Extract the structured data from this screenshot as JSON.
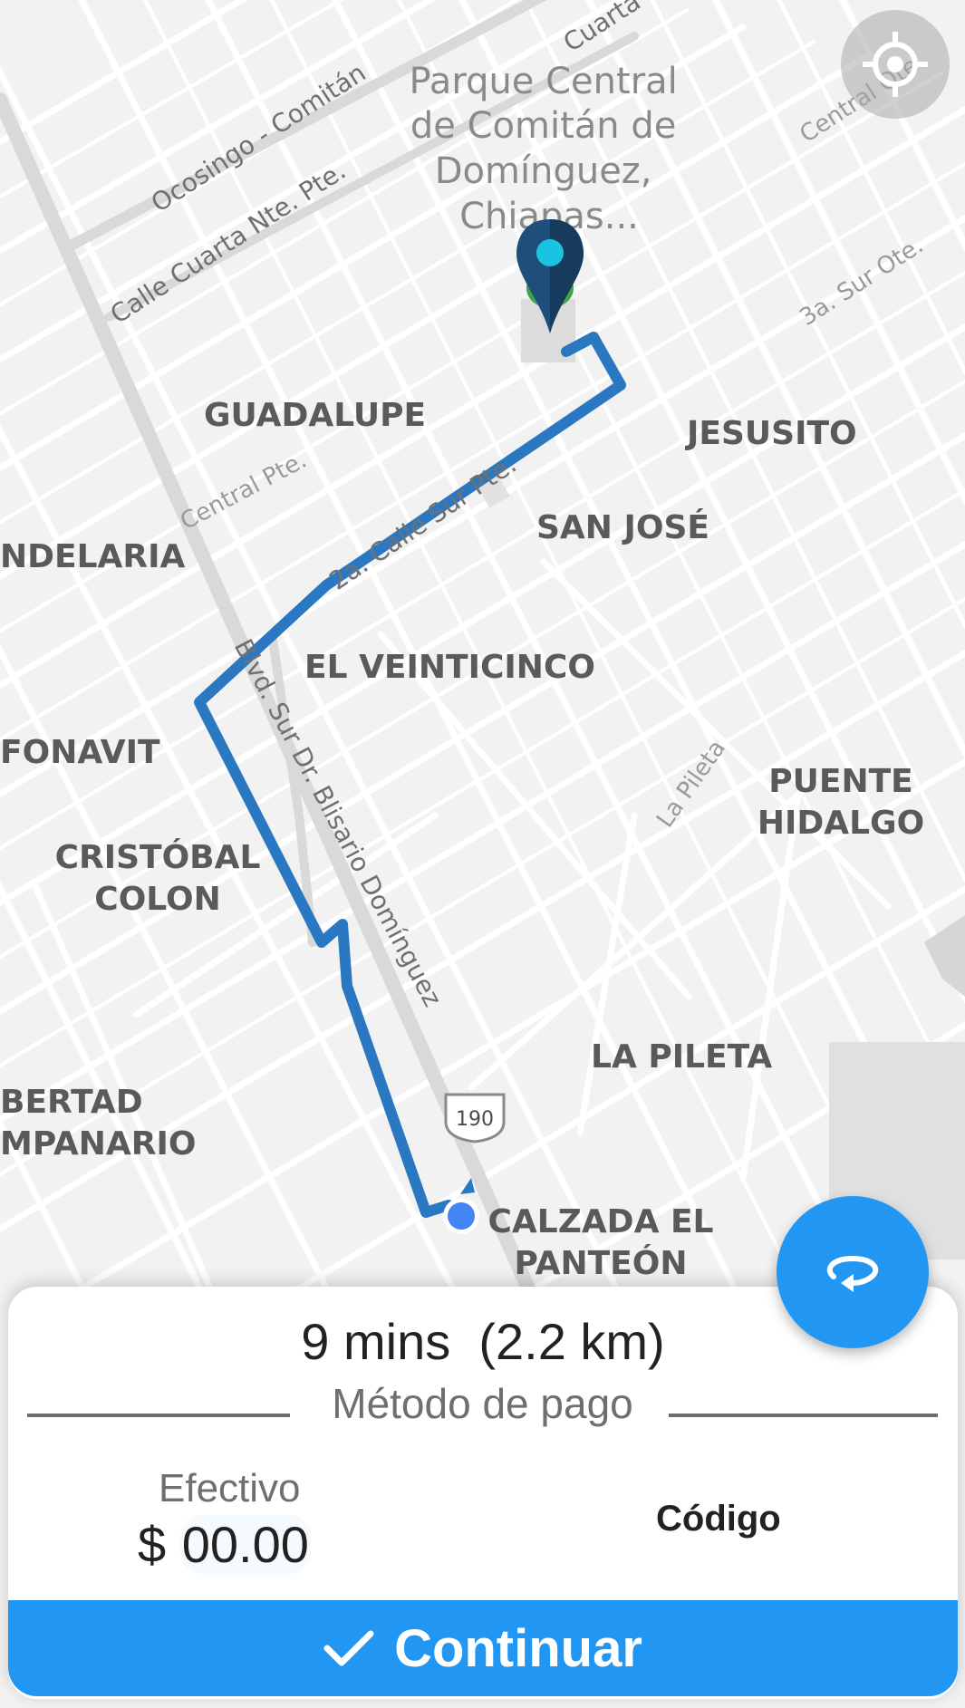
{
  "map": {
    "poi_label_lines": [
      "Parque Central",
      "de Comitán de",
      "Domínguez,",
      "Chiapas..."
    ],
    "road_labels": {
      "ocosingo": "Ocosingo - Comitán",
      "cuarta_nte": "Calle Cuarta Nte. Pte.",
      "cuarta_top": "Cuarta",
      "central_ote": "Central Ote.",
      "sur_ote": "3a. Sur Ote.",
      "central_pte": "Central Pte.",
      "segunda_sur": "2a. Calle Sur Pte.",
      "boulevard": "Blvd. Sur Dr. Blisario Domínguez",
      "la_pileta_road": "La Pileta",
      "highway_shield": "190"
    },
    "neighborhoods": {
      "guadalupe": "GUADALUPE",
      "jesusito": "JESUSITO",
      "candelaria": "NDELARIA",
      "san_jose": "SAN JOSÉ",
      "el_veinticinco": "EL VEINTICINCO",
      "fonavit": "FONAVIT",
      "puente_l1": "PUENTE",
      "puente_l2": "HIDALGO",
      "cristobal_l1": "CRISTÓBAL",
      "cristobal_l2": "COLON",
      "la_pileta": "LA PILETA",
      "libertad_l1": "BERTAD",
      "libertad_l2": "MPANARIO",
      "calzada_l1": "CALZADA EL",
      "calzada_l2": "PANTEÓN"
    },
    "route_color": "#2b78c2",
    "destination_pin_color": "#1f4e7a",
    "origin_dot_color": "#4285f4"
  },
  "buttons": {
    "my_location_icon": "crosshair-icon",
    "swap_icon": "refresh-arrow-icon"
  },
  "trip": {
    "summary": "9 mins  (2.2 km)"
  },
  "payment": {
    "section_label": "Método de pago",
    "method": "Efectivo",
    "currency": "$",
    "amount_value": "00.00",
    "code_label": "Código"
  },
  "continue_button": {
    "label": "Continuar",
    "icon": "check-icon",
    "color": "#2196f3"
  }
}
